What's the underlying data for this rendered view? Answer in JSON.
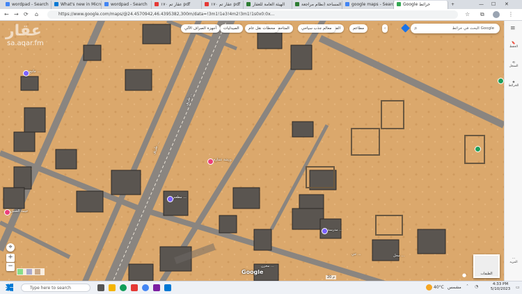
{
  "tabs": [
    {
      "label": "wordpad - Search",
      "color": "#4285f4"
    },
    {
      "label": "What's new in Micros",
      "color": "#0078d4"
    },
    {
      "label": "wordpad - Search",
      "color": "#4285f4"
    },
    {
      "label": "عقار تم ١٧٠ pdf",
      "color": "#e53935"
    },
    {
      "label": "عقار تم ١٧٠ pdf",
      "color": "#e53935"
    },
    {
      "label": "الهيئة العامة للعقار",
      "color": "#2e7d32"
    },
    {
      "label": "المساحة (نظام مراجعة",
      "color": "#2e7d32"
    },
    {
      "label": "google maps - Search",
      "color": "#4285f4"
    },
    {
      "label": "Google خرائط",
      "color": "#34a853"
    }
  ],
  "url": "https://www.google.com/maps/@24.4570942,46.4395382,300m/data=!3m1!1e3!4m2!3m1!1s0x0:0x…",
  "map": {
    "search_placeholder": "البحث في خرائط Google",
    "chips": [
      "مطاعم",
      "الفنادق",
      "معالم جذب سياحي",
      "المتاحف",
      "محطات نقل عام",
      "الصيدليات",
      "أجهزة الصراف الآلي"
    ],
    "road_labels": [
      "طريق ...",
      "طريق ..."
    ],
    "place_labels": [
      "جامع ...",
      "خيمة العميل",
      "ورشة عمارة",
      "مطعم ...",
      "مدرسة ...",
      "حي ...",
      "محل ...",
      "مخزن ..."
    ],
    "scale": "20 م",
    "layers_label": "الطبقات",
    "google_logo": "Google"
  },
  "watermark": {
    "top": "عقار",
    "site": "sa.aqar.fm"
  },
  "right_panel": [
    "الحفظ",
    "السجل",
    "الخرائط",
    "المزيد"
  ],
  "taskbar": {
    "search_placeholder": "Type here to search",
    "temp": "40°C",
    "weather": "مشمس",
    "time": "4:33 PM",
    "date": "5/10/2023"
  }
}
